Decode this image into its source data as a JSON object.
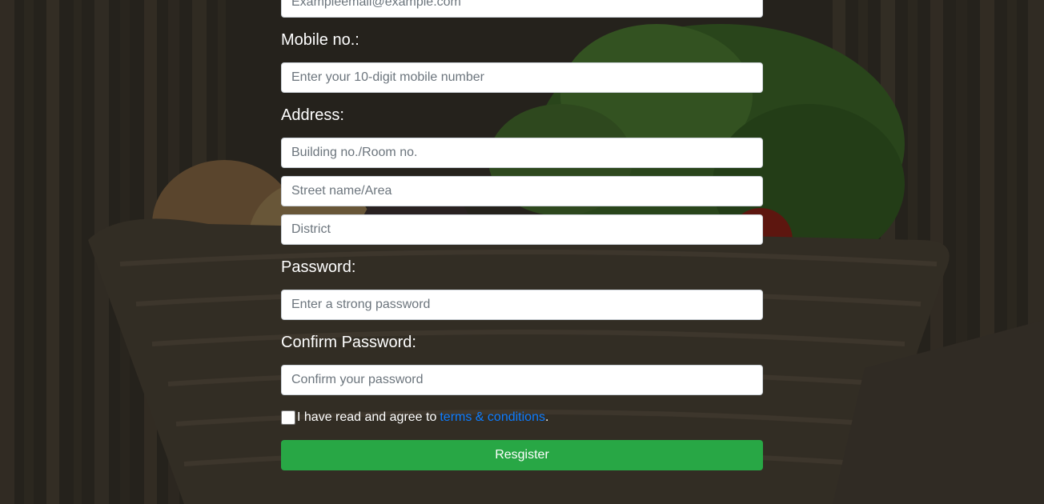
{
  "form": {
    "email_placeholder": "Exampleemail@example.com",
    "mobile_label": "Mobile no.:",
    "mobile_placeholder": "Enter your 10-digit mobile number",
    "address_label": "Address:",
    "building_placeholder": "Building no./Room no.",
    "street_placeholder": "Street name/Area",
    "district_placeholder": "District",
    "password_label": "Password:",
    "password_placeholder": "Enter a strong password",
    "confirm_label": "Confirm Password:",
    "confirm_placeholder": "Confirm your password",
    "agree_text": "I have read and agree to",
    "terms_link": "terms & conditions",
    "agree_period": ".",
    "register_label": "Resgister"
  },
  "colors": {
    "button": "#28a745",
    "link": "#0d7cff",
    "label_text": "#ffffff"
  }
}
